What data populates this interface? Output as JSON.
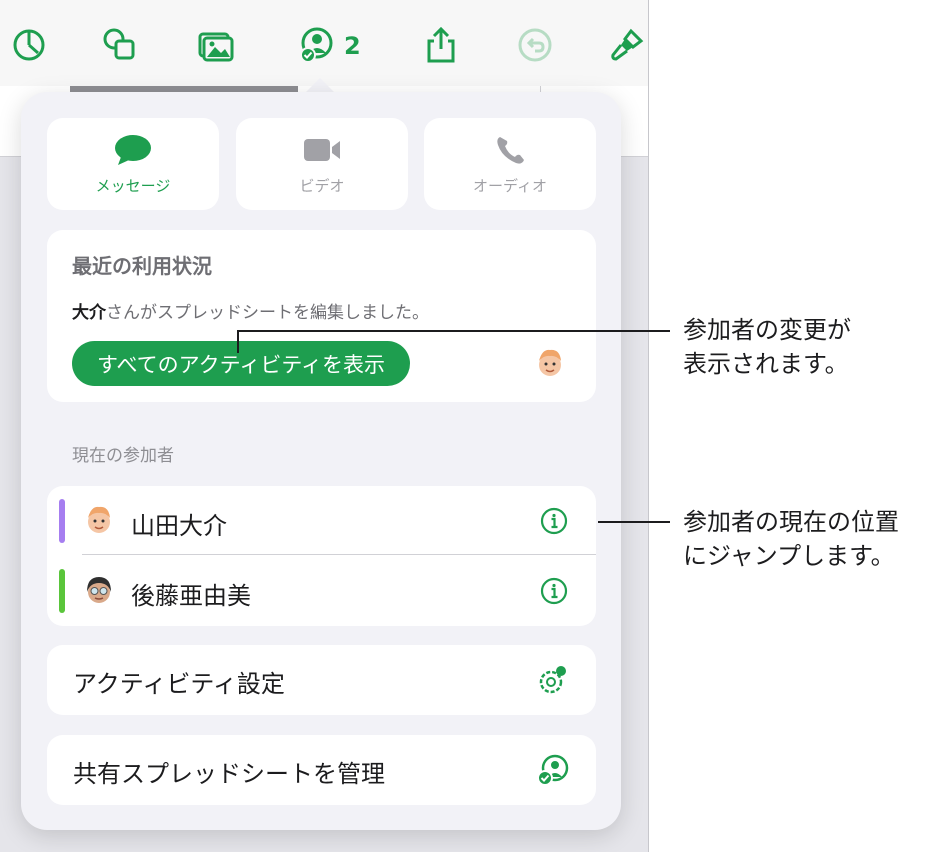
{
  "toolbar": {
    "collaborators_count": "2",
    "icons": [
      "clock-icon",
      "shapes-icon",
      "media-icon",
      "collaboration-icon",
      "share-icon",
      "undo-icon",
      "format-brush-icon"
    ]
  },
  "communication": {
    "message": "メッセージ",
    "video": "ビデオ",
    "audio": "オーディオ"
  },
  "recent_activity": {
    "title": "最近の利用状況",
    "user": "大介",
    "text_suffix": "さんがスプレッドシートを編集しました。",
    "show_all_button": "すべてのアクティビティを表示"
  },
  "participants": {
    "title": "現在の参加者",
    "items": [
      {
        "name": "山田大介",
        "color": "#a67ef0"
      },
      {
        "name": "後藤亜由美",
        "color": "#5ac53b"
      }
    ]
  },
  "menu": {
    "activity_settings": "アクティビティ設定",
    "manage_shared": "共有スプレッドシートを管理"
  },
  "callouts": {
    "changes": "参加者の変更が\n表示されます。",
    "jump": "参加者の現在の位置\nにジャンプします。"
  },
  "colors": {
    "accent": "#1e9e4f",
    "background": "#f2f2f7"
  }
}
